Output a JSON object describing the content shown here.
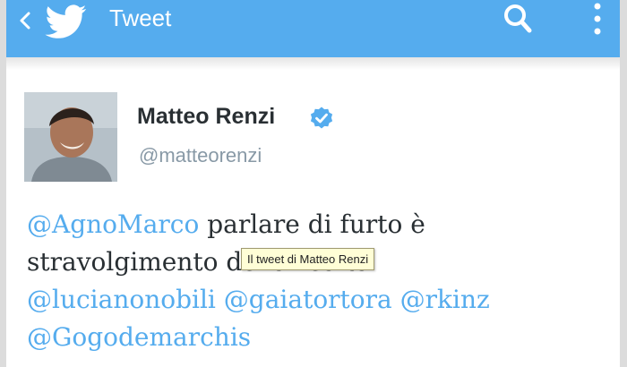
{
  "app": {
    "header": {
      "back_icon": "chevron-left-icon",
      "logo_icon": "twitter-bird-icon",
      "title": "Tweet",
      "search_icon": "search-icon",
      "menu_icon": "more-vertical-icon",
      "background_color": "#55acee"
    }
  },
  "tweet": {
    "author": {
      "name": "Matteo Renzi",
      "handle": "@matteorenzi",
      "verified": true,
      "verified_icon": "verified-badge-icon"
    },
    "lines": [
      [
        {
          "text": "@AgnoMarco",
          "type": "mention"
        },
        {
          "text": " parlare di furto è",
          "type": "text"
        }
      ],
      [
        {
          "text": "stravolgimento della realtà",
          "type": "text"
        }
      ],
      [
        {
          "text": "@lucianonobili",
          "type": "mention"
        },
        {
          "text": " ",
          "type": "text"
        },
        {
          "text": "@gaiatortora",
          "type": "mention"
        },
        {
          "text": " ",
          "type": "text"
        },
        {
          "text": "@rkinz",
          "type": "mention"
        }
      ],
      [
        {
          "text": "@Gogodemarchis",
          "type": "mention"
        }
      ]
    ],
    "link_color": "#55acee",
    "text_color": "#292f33"
  },
  "tooltip": {
    "text": "Il tweet di Matteo Renzi"
  }
}
